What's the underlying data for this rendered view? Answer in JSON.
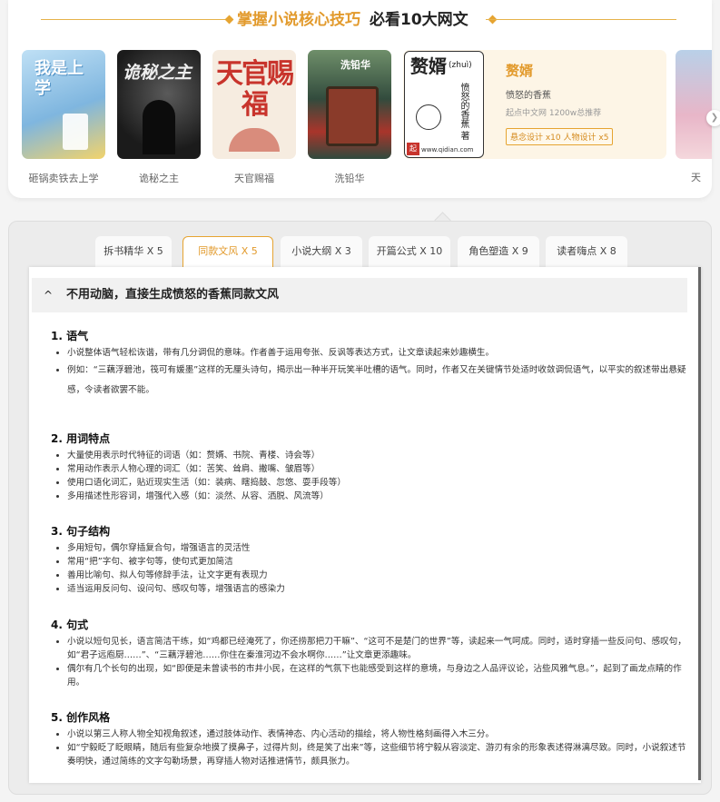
{
  "header": {
    "title_highlight": "掌握小说核心技巧",
    "title_rest": "必看10大网文"
  },
  "books": [
    {
      "name": "砸锅卖铁去上学",
      "cover_text": "我是上学",
      "color": "#9ecbe9"
    },
    {
      "name": "诡秘之主",
      "cover_text": "诡秘之主",
      "color": "#2a2a2a"
    },
    {
      "name": "天官赐福",
      "cover_text": "天官赐福",
      "color": "#f3e6d6"
    },
    {
      "name": "洗铅华",
      "cover_text": "洗铅华",
      "color": "#2f4a3e"
    }
  ],
  "featured": {
    "title": "赘婿",
    "author": "愤怒的香蕉",
    "stats": "起点中文网 1200w总推荐",
    "badge": "悬念设计 x10 人物设计 x5",
    "cover_title": "赘婿",
    "cover_pinyin": "(zhuì)",
    "cover_author": "愤怒的香蕉 著",
    "cover_url": "www.qidian.com"
  },
  "edge_book": {
    "name": "天"
  },
  "tabs": [
    {
      "label": "拆书精华 X 5",
      "active": false
    },
    {
      "label": "同款文风 X 5",
      "active": true
    },
    {
      "label": "小说大纲 X 3",
      "active": false
    },
    {
      "label": "开篇公式 X 10",
      "active": false
    },
    {
      "label": "角色塑造 X 9",
      "active": false
    },
    {
      "label": "读者嗨点 X 8",
      "active": false
    }
  ],
  "content": {
    "caret": "^",
    "title": "不用动脑，直接生成愤怒的香蕉同款文风",
    "sections": [
      {
        "heading": "1. 语气",
        "items": [
          "小说整体语气轻松诙谐，带有几分调侃的意味。作者善于运用夸张、反讽等表达方式，让文章读起来妙趣横生。",
          "例如：“三藕浮碧池，筏可有媛墨”这样的无厘头诗句，揭示出一种半开玩笑半吐槽的语气。同时，作者又在关键情节处适时收敛调侃语气，以平实的叙述带出悬疑感，令读者欲罢不能。"
        ]
      },
      {
        "heading": "2. 用词特点",
        "items": [
          "大量使用表示时代特征的词语（如：赘婿、书院、青楼、诗会等）",
          "常用动作表示人物心理的词汇（如：苦笑、耸肩、撇嘴、皱眉等）",
          "使用口语化词汇，贴近现实生活（如：装病、瞎捣鼓、忽悠、耍手段等）",
          "多用描述性形容词，增强代入感（如：淡然、从容、洒脱、风流等）"
        ]
      },
      {
        "heading": "3. 句子结构",
        "items": [
          "多用短句，偶尔穿插复合句，增强语言的灵活性",
          "常用“把”字句、被字句等，使句式更加简洁",
          "善用比喻句、拟人句等修辞手法，让文字更有表现力",
          "适当运用反问句、设问句、感叹句等，增强语言的感染力"
        ]
      },
      {
        "heading": "4. 句式",
        "items": [
          "小说以短句见长，语言简洁干练，如“鸡都已经淹死了，你还捞那把刀干嘛”、“这可不是楚门的世界”等，读起来一气呵成。同时，适时穿插一些反问句、感叹句，如“君子远庖厨……”、“三藕浮碧池……你住在秦淮河边不会水啊你……”让文章更添趣味。",
          "偶尔有几个长句的出现，如“即便是未曾读书的市井小民，在这样的气氛下也能感受到这样的意境，与身边之人品评议论，沾些风雅气息。”，起到了画龙点睛的作用。"
        ]
      },
      {
        "heading": "5. 创作风格",
        "items": [
          "小说以第三人称人物全知视角叙述，通过肢体动作、表情神态、内心活动的描绘，将人物性格刻画得入木三分。",
          "如“宁毅眨了眨眼睛，随后有些复杂地摸了摸鼻子，过得片刻，终是笑了出来”等，这些细节将宁毅从容淡定、游刃有余的形象表述得淋漓尽致。同时，小说叙述节奏明快，通过简练的文字勾勒场景，再穿插人物对话推进情节，颇具张力。"
        ]
      }
    ]
  }
}
